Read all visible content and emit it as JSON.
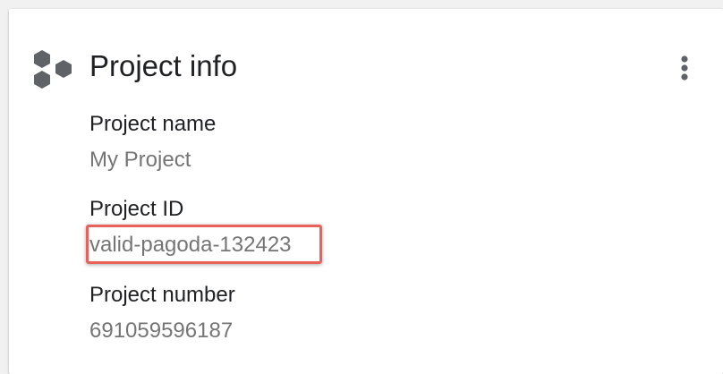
{
  "card": {
    "title": "Project info",
    "icon": "hexagons-icon",
    "menu_icon": "more-vert-icon"
  },
  "fields": [
    {
      "label": "Project name",
      "value": "My Project"
    },
    {
      "label": "Project ID",
      "value": "valid-pagoda-132423",
      "highlighted": true
    },
    {
      "label": "Project number",
      "value": "691059596187"
    }
  ],
  "colors": {
    "title": "#202124",
    "label": "#202124",
    "value": "#757575",
    "icon": "#5f6368",
    "highlight": "#e8615b"
  }
}
